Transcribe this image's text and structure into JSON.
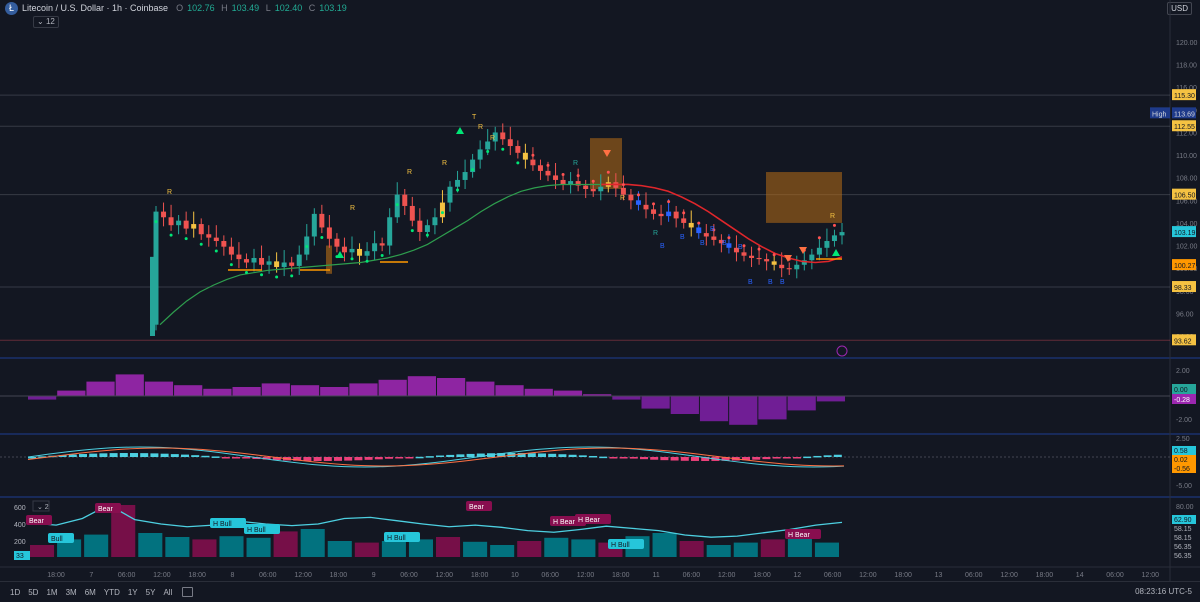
{
  "header": {
    "symbol": "Litecoin / U.S. Dollar · 1h · Coinbase",
    "ohlc": [
      {
        "k": "O",
        "v": "102.76"
      },
      {
        "k": "H",
        "v": "103.49"
      },
      {
        "k": "L",
        "v": "102.40"
      },
      {
        "k": "C",
        "v": "103.19"
      }
    ],
    "indicator_count": "12",
    "currency": "USD"
  },
  "colors": {
    "bg": "#131722",
    "up": "#26a69a",
    "down": "#ef5350",
    "yellow": "#f5c242",
    "purple": "#9c27b0",
    "cyan": "#4dd0e1",
    "maroon": "#880e4f",
    "orange": "#ff9800"
  },
  "price_axis": {
    "ticks": [
      "120.00",
      "118.00",
      "116.00",
      "114.00",
      "112.00",
      "110.00",
      "108.00",
      "106.00",
      "104.00",
      "102.00",
      "100.00",
      "98.00",
      "96.00",
      "94.00"
    ],
    "labels": [
      {
        "text": "115.30",
        "color": "yellow"
      },
      {
        "text": "113.69",
        "color": "navy",
        "prefix": "High"
      },
      {
        "text": "112.55",
        "color": "yellow"
      },
      {
        "text": "106.50",
        "color": "yellow"
      },
      {
        "text": "103.19",
        "color": "cyan"
      },
      {
        "text": "100.27",
        "color": "orange"
      },
      {
        "text": "98.33",
        "color": "yellow"
      },
      {
        "text": "93.62",
        "color": "yellow"
      }
    ]
  },
  "markers": {
    "R": [
      "R",
      "R",
      "R",
      "R",
      "R",
      "R",
      "R",
      "R",
      "R",
      "R"
    ],
    "B": [
      "B",
      "B",
      "B",
      "B",
      "B",
      "B",
      "B",
      "B",
      "B"
    ],
    "T": "T"
  },
  "macd_axis": {
    "ticks": [
      "2.00",
      "-2.00"
    ],
    "labels": [
      {
        "text": "0.00",
        "color": "green"
      },
      {
        "text": "-0.28",
        "color": "purple"
      }
    ]
  },
  "osc_axis": {
    "ticks": [
      "2.50",
      "-2.50",
      "-5.00"
    ],
    "labels": [
      {
        "text": "0.58",
        "color": "cyan"
      },
      {
        "text": "0.02",
        "color": "orange"
      },
      {
        "text": "-0.56",
        "color": "orange"
      }
    ]
  },
  "vol_panel": {
    "chip": "2",
    "left_ticks": [
      "600",
      "400",
      "200"
    ],
    "axis_ticks": [
      "80.00"
    ],
    "labels": [
      {
        "text": "62.90",
        "color": "cyan"
      },
      {
        "text": "58.15"
      },
      {
        "text": "58.15"
      },
      {
        "text": "56.35"
      },
      {
        "text": "56.35"
      }
    ],
    "badge": "33",
    "bull_bear": [
      "Bear",
      "Bear",
      "Bear",
      "H Bear",
      "H Bear",
      "H Bear",
      "Bull",
      "H Bull",
      "H Bull",
      "H Bull",
      "H Bull"
    ]
  },
  "time_axis": [
    "18:00",
    "7",
    "06:00",
    "12:00",
    "18:00",
    "8",
    "06:00",
    "12:00",
    "18:00",
    "9",
    "06:00",
    "12:00",
    "18:00",
    "10",
    "06:00",
    "12:00",
    "18:00",
    "11",
    "06:00",
    "12:00",
    "18:00",
    "12",
    "06:00",
    "12:00",
    "18:00",
    "13",
    "06:00",
    "12:00",
    "18:00",
    "14",
    "06:00",
    "12:00"
  ],
  "bottom_bar": {
    "timeframes": [
      "1D",
      "5D",
      "1M",
      "3M",
      "6M",
      "YTD",
      "1Y",
      "5Y",
      "All"
    ],
    "clock": "08:23:16 UTC-5"
  },
  "chart_data": {
    "type": "candlestick",
    "x_start_label": "18:00",
    "closes": [
      105,
      104.5,
      103.8,
      104.2,
      103.5,
      103.9,
      103,
      102.7,
      102.4,
      101.9,
      101.2,
      100.8,
      100.5,
      100.9,
      100.3,
      100.6,
      100.1,
      100.5,
      100.2,
      101.2,
      102.8,
      104.8,
      103.6,
      102.6,
      101.9,
      101.4,
      101.7,
      101.1,
      101.5,
      102.2,
      102,
      104.5,
      106.5,
      105.5,
      104.2,
      103.2,
      103.8,
      104.5,
      105.8,
      107.2,
      107.8,
      108.5,
      109.6,
      110.5,
      111.2,
      112,
      111.4,
      110.8,
      110.2,
      109.6,
      109.1,
      108.6,
      108.2,
      107.8,
      107.4,
      107.7,
      107.3,
      107,
      106.8,
      107.2,
      107.6,
      107.1,
      106.5,
      106,
      105.6,
      105.2,
      104.8,
      104.6,
      105,
      104.4,
      104,
      103.6,
      103.1,
      102.8,
      102.5,
      102.2,
      101.8,
      101.4,
      101.1,
      100.9,
      100.8,
      100.6,
      100.3,
      100,
      99.9,
      100.3,
      100.7,
      101.2,
      101.8,
      102.4,
      102.9,
      103.19
    ],
    "ma_values": [
      95,
      96.1,
      97.1,
      97.9,
      98.5,
      99,
      99.4,
      99.6,
      99.8,
      99.9,
      100,
      100.1,
      100.2,
      100.3,
      100.4,
      100.5,
      100.7,
      100.9,
      101.2,
      101.6,
      102.1,
      102.8,
      103.5,
      104.2,
      105,
      105.7,
      106.3,
      106.8,
      107.1,
      107.3,
      107.4,
      107.4,
      107.4,
      107.4,
      107.4,
      107.4,
      107.3,
      107.1,
      106.8,
      106.3,
      105.7,
      105,
      104.2,
      103.4,
      102.6,
      101.9,
      101.3,
      100.9,
      100.6,
      100.5,
      100.6,
      101
    ],
    "bands": [
      [
        107,
        111.5
      ],
      [
        104,
        108.5
      ],
      [
        99.5,
        104.5
      ]
    ],
    "macd_hist": [
      -0.2,
      0.3,
      0.8,
      1.2,
      0.8,
      0.6,
      0.4,
      0.5,
      0.7,
      0.6,
      0.5,
      0.7,
      0.9,
      1.1,
      1,
      0.8,
      0.6,
      0.4,
      0.3,
      0.1,
      -0.2,
      -0.7,
      -1,
      -1.4,
      -1.6,
      -1.3,
      -0.8,
      -0.3
    ],
    "rsi_line": [
      62,
      58,
      70,
      95,
      68,
      60,
      55,
      58,
      65,
      60,
      57,
      60,
      70,
      72,
      66,
      60,
      55,
      58,
      54,
      48,
      45,
      50,
      56,
      52,
      48,
      40,
      36,
      38,
      44,
      50,
      58,
      62.9
    ],
    "volume": [
      150,
      220,
      280,
      650,
      300,
      250,
      220,
      260,
      240,
      320,
      350,
      200,
      180,
      200,
      220,
      250,
      190,
      150,
      200,
      240,
      220,
      180,
      260,
      300,
      200,
      150,
      180,
      220,
      250,
      180
    ]
  }
}
